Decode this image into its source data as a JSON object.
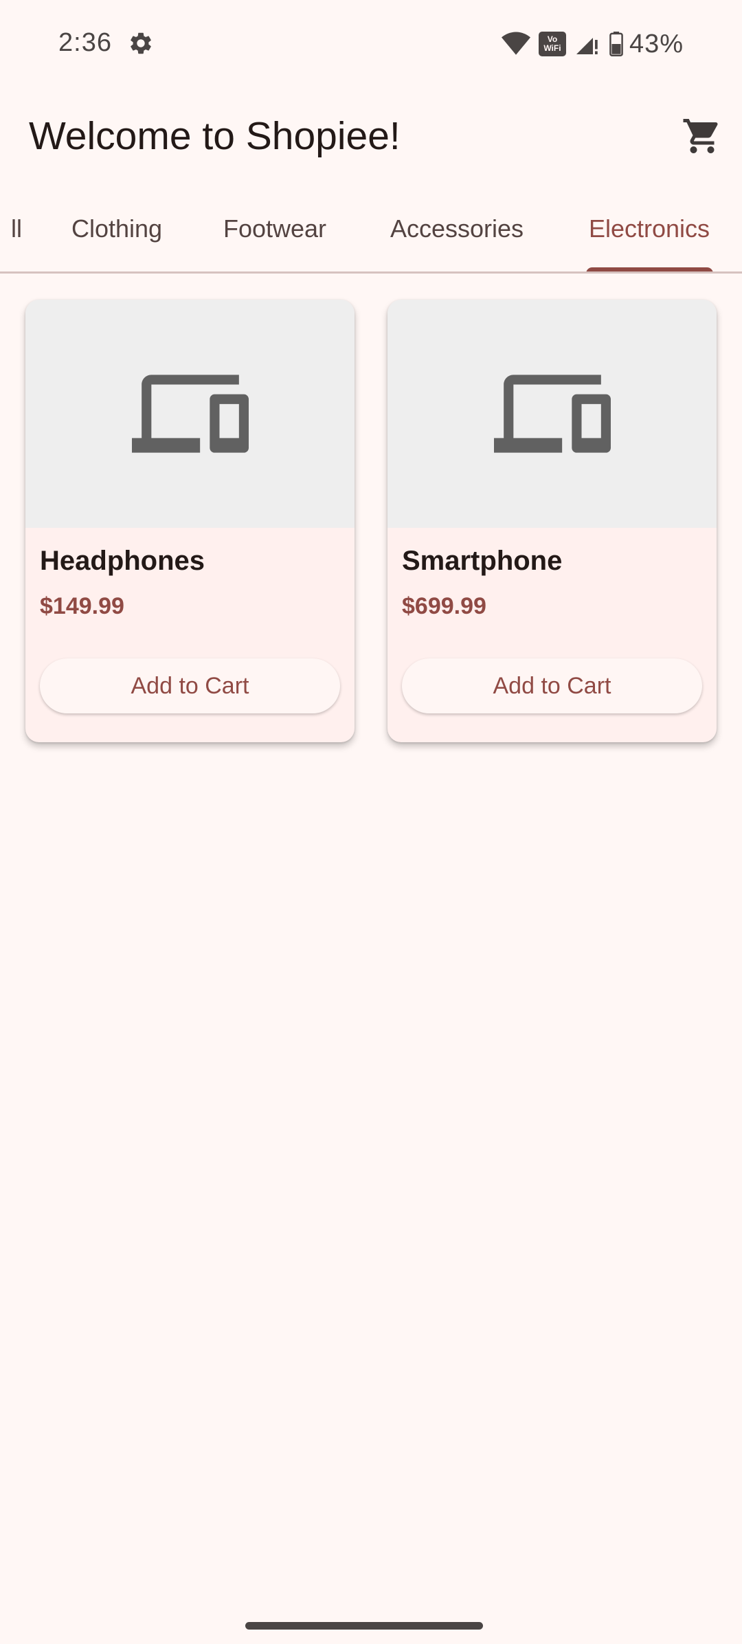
{
  "status_bar": {
    "time": "2:36",
    "settings_icon": "gear-icon",
    "wifi_icon": "wifi-icon",
    "vowifi_top": "Vo",
    "vowifi_bottom": "WiFi",
    "signal_icon": "signal-icon",
    "battery_icon": "battery-icon",
    "battery_percent": "43%"
  },
  "app_bar": {
    "title": "Welcome to Shopiee!",
    "cart_icon": "cart-icon"
  },
  "tabs": {
    "items": [
      {
        "label": "All",
        "visible_text": "ll",
        "active": false
      },
      {
        "label": "Clothing",
        "active": false
      },
      {
        "label": "Footwear",
        "active": false
      },
      {
        "label": "Accessories",
        "active": false
      },
      {
        "label": "Electronics",
        "active": true
      }
    ]
  },
  "products": [
    {
      "name": "Headphones",
      "price": "$149.99",
      "image_icon": "devices-icon",
      "button_label": "Add to Cart"
    },
    {
      "name": "Smartphone",
      "price": "$699.99",
      "image_icon": "devices-icon",
      "button_label": "Add to Cart"
    }
  ],
  "colors": {
    "background": "#fff7f5",
    "accent": "#904a44",
    "card_background": "#fff0ee",
    "image_background": "#eeeeee",
    "icon_gray": "#616161",
    "text_primary": "#231917",
    "text_secondary": "#534341"
  }
}
